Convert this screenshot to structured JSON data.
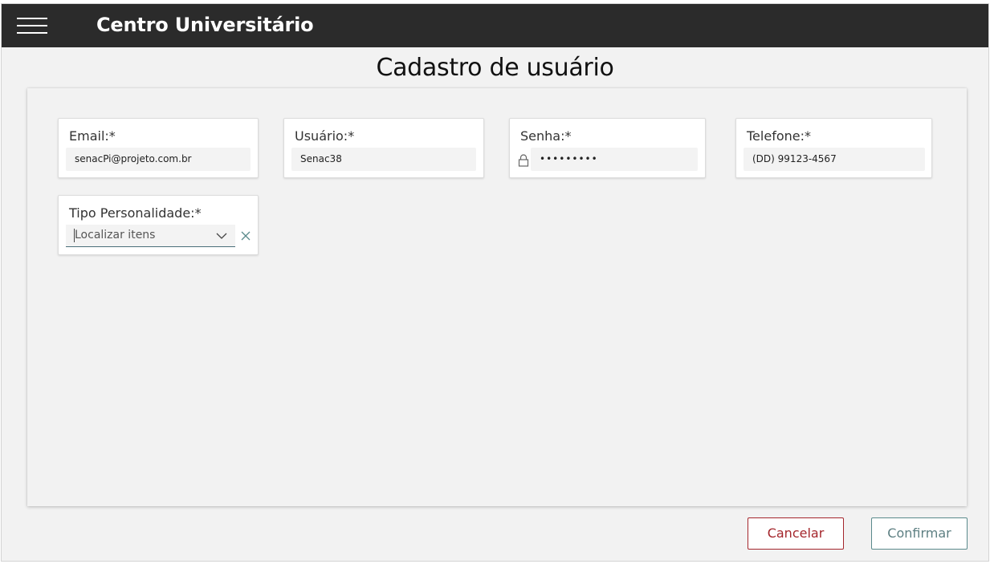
{
  "header": {
    "menu_icon": "hamburger-menu-icon",
    "title": "Centro Universitário"
  },
  "page": {
    "title": "Cadastro de usuário"
  },
  "form": {
    "email": {
      "label": "Email:*",
      "value": "senacPi@projeto.com.br"
    },
    "usuario": {
      "label": "Usuário:*",
      "value": "Senac38"
    },
    "senha": {
      "label": "Senha:*",
      "value": "•••••••••",
      "icon": "lock-icon"
    },
    "telefone": {
      "label": "Telefone:*",
      "value": "(DD) 99123-4567"
    },
    "tipo_personalidade": {
      "label": "Tipo Personalidade:*",
      "placeholder": "Localizar itens",
      "icons": [
        "chevron-down-icon",
        "clear-icon"
      ]
    }
  },
  "actions": {
    "cancel_label": "Cancelar",
    "confirm_label": "Confirmar"
  },
  "colors": {
    "topbar": "#2b2b2b",
    "cancel": "#a4262c",
    "confirm": "#5a8a8c",
    "background": "#f2f2f2"
  }
}
